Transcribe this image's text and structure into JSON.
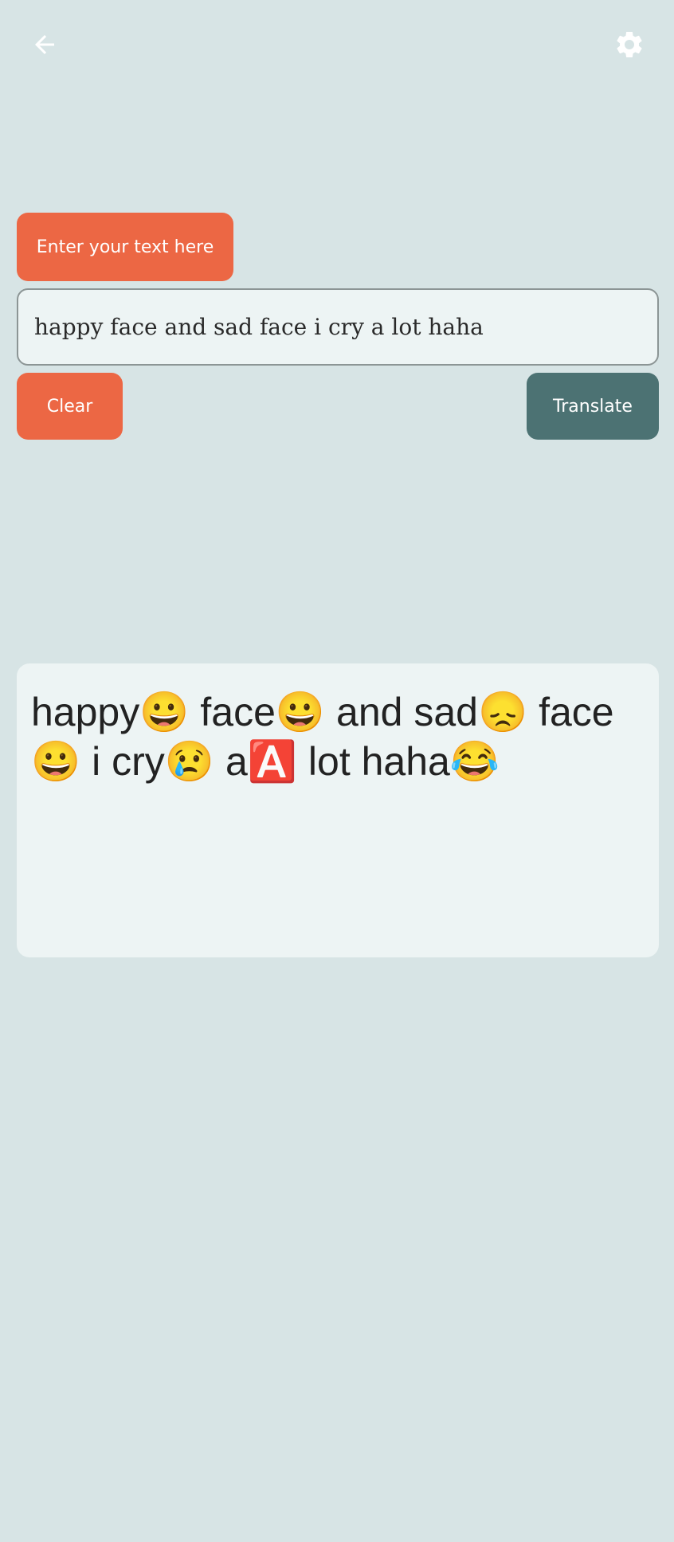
{
  "topbar": {
    "back_icon": "arrow-left-icon",
    "settings_icon": "gear-icon"
  },
  "input_section": {
    "label": "Enter your text here",
    "value": "happy face and sad face i cry a lot haha"
  },
  "actions": {
    "clear_label": "Clear",
    "translate_label": "Translate"
  },
  "output": {
    "text": "happy😀 face😀 and sad😞 face😀 i cry😢 a🅰️ lot haha😂"
  },
  "colors": {
    "background": "#d7e4e5",
    "accent_orange": "#ec6744",
    "accent_teal": "#4c7273",
    "card": "#edf4f4"
  }
}
